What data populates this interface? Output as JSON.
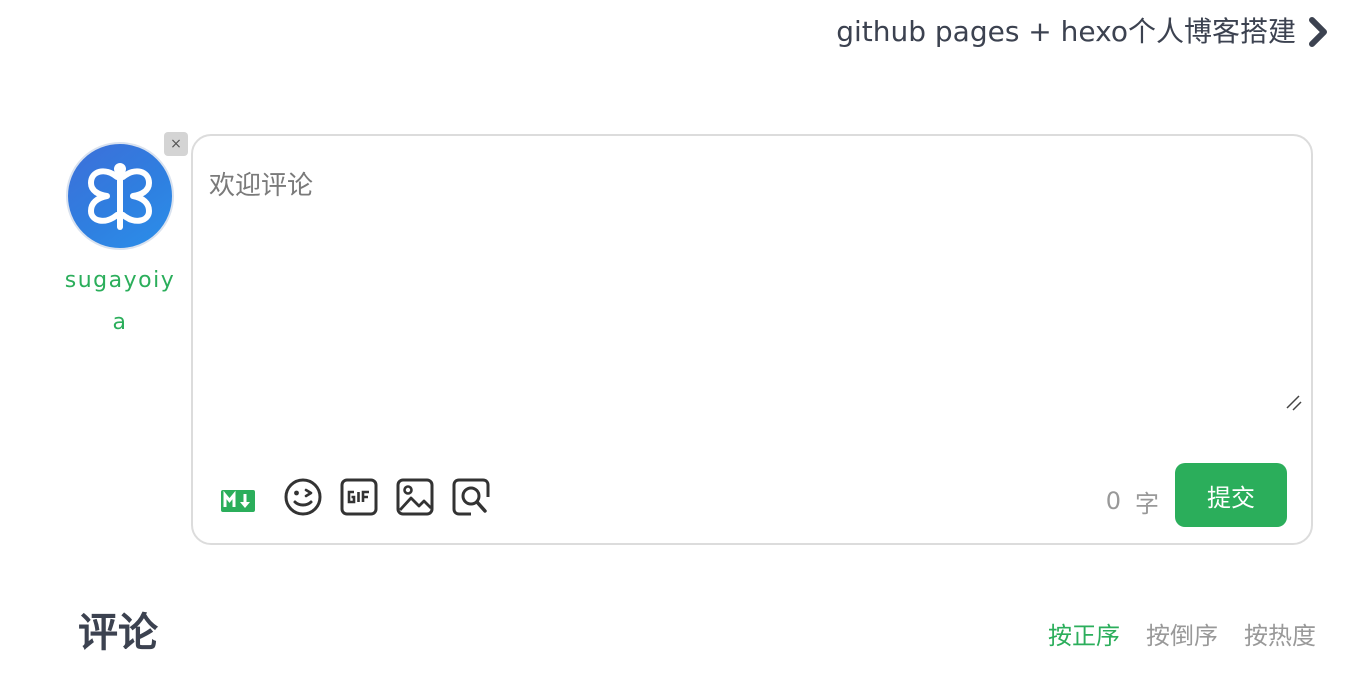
{
  "next_post": {
    "title": "github pages + hexo个人博客搭建",
    "icon": "chevron-right-icon"
  },
  "user": {
    "name": "sugayoiya",
    "avatar_icon": "butterfly-logo-icon",
    "close_icon": "close-icon",
    "close_glyph": "×"
  },
  "editor": {
    "placeholder": "欢迎评论",
    "value": "",
    "char_count": "0",
    "char_unit": "字",
    "submit_label": "提交",
    "toolbar": [
      "markdown-icon",
      "emoji-icon",
      "gif-icon",
      "image-icon",
      "preview-icon"
    ]
  },
  "comments": {
    "title": "评论",
    "sort_options": [
      "按正序",
      "按倒序",
      "按热度"
    ],
    "active_sort": "按正序"
  },
  "colors": {
    "accent": "#2bae5b",
    "text_dark": "#3c4250",
    "muted": "#999999",
    "border": "#dcdcdc"
  }
}
